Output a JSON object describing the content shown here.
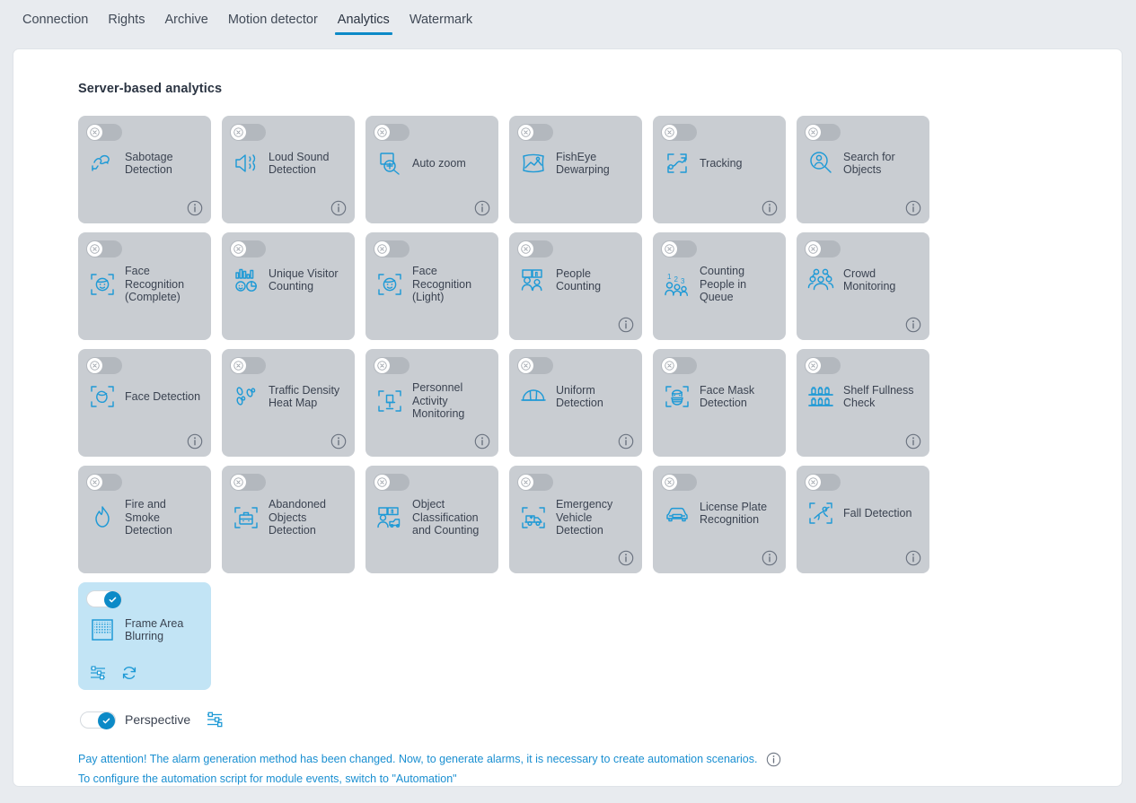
{
  "tabs": [
    {
      "label": "Connection",
      "active": false
    },
    {
      "label": "Rights",
      "active": false
    },
    {
      "label": "Archive",
      "active": false
    },
    {
      "label": "Motion detector",
      "active": false
    },
    {
      "label": "Analytics",
      "active": true
    },
    {
      "label": "Watermark",
      "active": false
    }
  ],
  "section": {
    "title": "Server-based analytics"
  },
  "colors": {
    "accent": "#0c8ac7",
    "link": "#1a8fd1",
    "card_off_bg": "#c9cdd2",
    "card_on_bg": "#c2e4f5",
    "icon_blue": "#1f9ad6",
    "text": "#3b4351"
  },
  "cards": [
    {
      "label": "Sabotage Detection",
      "icon": "sabotage-icon",
      "enabled": false,
      "info": true
    },
    {
      "label": "Loud Sound Detection",
      "icon": "loud-sound-icon",
      "enabled": false,
      "info": true
    },
    {
      "label": "Auto zoom",
      "icon": "auto-zoom-icon",
      "enabled": false,
      "info": true
    },
    {
      "label": "FishEye Dewarping",
      "icon": "fisheye-dewarping-icon",
      "enabled": false,
      "info": false
    },
    {
      "label": "Tracking",
      "icon": "tracking-icon",
      "enabled": false,
      "info": true
    },
    {
      "label": "Search for Objects",
      "icon": "search-objects-icon",
      "enabled": false,
      "info": true
    },
    {
      "label": "Face Recognition (Complete)",
      "icon": "face-recognition-complete-icon",
      "enabled": false,
      "info": false
    },
    {
      "label": "Unique Visitor Counting",
      "icon": "unique-visitor-counting-icon",
      "enabled": false,
      "info": false
    },
    {
      "label": "Face Recognition (Light)",
      "icon": "face-recognition-light-icon",
      "enabled": false,
      "info": false
    },
    {
      "label": "People Counting",
      "icon": "people-counting-icon",
      "enabled": false,
      "info": true
    },
    {
      "label": "Counting People in Queue",
      "icon": "counting-people-queue-icon",
      "enabled": false,
      "info": false
    },
    {
      "label": "Crowd Monitoring",
      "icon": "crowd-monitoring-icon",
      "enabled": false,
      "info": true
    },
    {
      "label": "Face Detection",
      "icon": "face-detection-icon",
      "enabled": false,
      "info": true
    },
    {
      "label": "Traffic Density Heat Map",
      "icon": "traffic-density-heatmap-icon",
      "enabled": false,
      "info": true
    },
    {
      "label": "Personnel Activity Monitoring",
      "icon": "personnel-activity-icon",
      "enabled": false,
      "info": true
    },
    {
      "label": "Uniform Detection",
      "icon": "uniform-detection-icon",
      "enabled": false,
      "info": true
    },
    {
      "label": "Face Mask Detection",
      "icon": "face-mask-detection-icon",
      "enabled": false,
      "info": false
    },
    {
      "label": "Shelf Fullness Check",
      "icon": "shelf-fullness-icon",
      "enabled": false,
      "info": true
    },
    {
      "label": "Fire and Smoke Detection",
      "icon": "fire-smoke-icon",
      "enabled": false,
      "info": false
    },
    {
      "label": "Abandoned Objects Detection",
      "icon": "abandoned-objects-icon",
      "enabled": false,
      "info": false
    },
    {
      "label": "Object Classification and Counting",
      "icon": "object-classification-icon",
      "enabled": false,
      "info": false
    },
    {
      "label": "Emergency Vehicle Detection",
      "icon": "emergency-vehicle-icon",
      "enabled": false,
      "info": true
    },
    {
      "label": "License Plate Recognition",
      "icon": "license-plate-icon",
      "enabled": false,
      "info": true
    },
    {
      "label": "Fall Detection",
      "icon": "fall-detection-icon",
      "enabled": false,
      "info": true
    },
    {
      "label": "Frame Area Blurring",
      "icon": "frame-blur-icon",
      "enabled": true,
      "info": false,
      "actions": [
        "settings-icon",
        "refresh-icon"
      ]
    }
  ],
  "perspective": {
    "label": "Perspective",
    "enabled": true,
    "settings_icon": "settings-icon"
  },
  "notice": {
    "line1": "Pay attention! The alarm generation method has been changed. Now, to generate alarms, it is necessary to create automation scenarios.",
    "line2": "To configure the automation script for module events, switch to \"Automation\"",
    "info_icon": "info-icon"
  }
}
